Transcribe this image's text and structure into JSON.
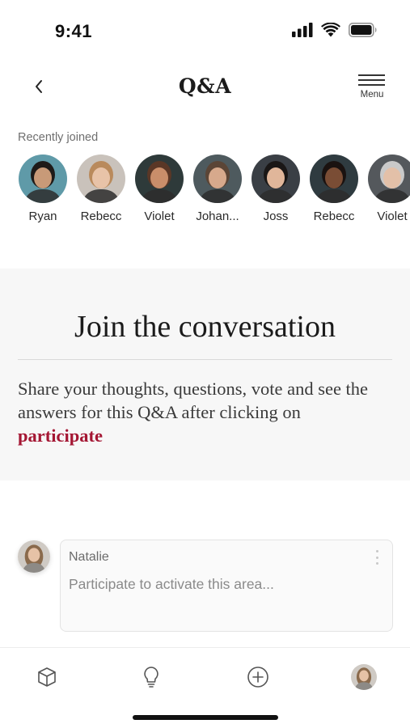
{
  "status_bar": {
    "time": "9:41"
  },
  "nav": {
    "title": "Q&A",
    "menu_label": "Menu",
    "back_icon": "chevron-left-icon",
    "menu_icon": "hamburger-icon"
  },
  "recently_joined": {
    "heading": "Recently joined",
    "people": [
      {
        "name": "Ryan",
        "bg": "#5f9aa8",
        "skin": "#c89a78",
        "hair": "#1e1a18"
      },
      {
        "name": "Rebecc",
        "bg": "#c9c2bb",
        "skin": "#e8c3a8",
        "hair": "#b98a5c"
      },
      {
        "name": "Violet",
        "bg": "#2e3a3a",
        "skin": "#c98e6a",
        "hair": "#5a3726"
      },
      {
        "name": "Johan...",
        "bg": "#4e5a5e",
        "skin": "#d7a98c",
        "hair": "#5b4536"
      },
      {
        "name": "Joss",
        "bg": "#3a3f45",
        "skin": "#e0b69a",
        "hair": "#1a1716"
      },
      {
        "name": "Rebecc",
        "bg": "#2f3b40",
        "skin": "#7a4d35",
        "hair": "#1a1210"
      },
      {
        "name": "Violet",
        "bg": "#54585c",
        "skin": "#e3c0a8",
        "hair": "#c9c9c9"
      }
    ]
  },
  "join_card": {
    "title": "Join the conversation",
    "body": "Share your thoughts, questions, vote and see the answers for this Q&A after clicking on",
    "link": "participate"
  },
  "composer": {
    "user_name": "Natalie",
    "placeholder": "Participate to activate this area...",
    "avatar": {
      "bg": "#cfcac4",
      "skin": "#e6c2a6",
      "hair": "#8a6a4c"
    }
  },
  "tab_bar": {
    "tabs": [
      {
        "icon": "cube-icon"
      },
      {
        "icon": "lightbulb-icon"
      },
      {
        "icon": "plus-circle-icon"
      },
      {
        "icon": "profile-avatar"
      }
    ]
  },
  "colors": {
    "accent": "#a41633",
    "card_bg": "#f7f7f7",
    "divider": "#d9d9d9"
  }
}
